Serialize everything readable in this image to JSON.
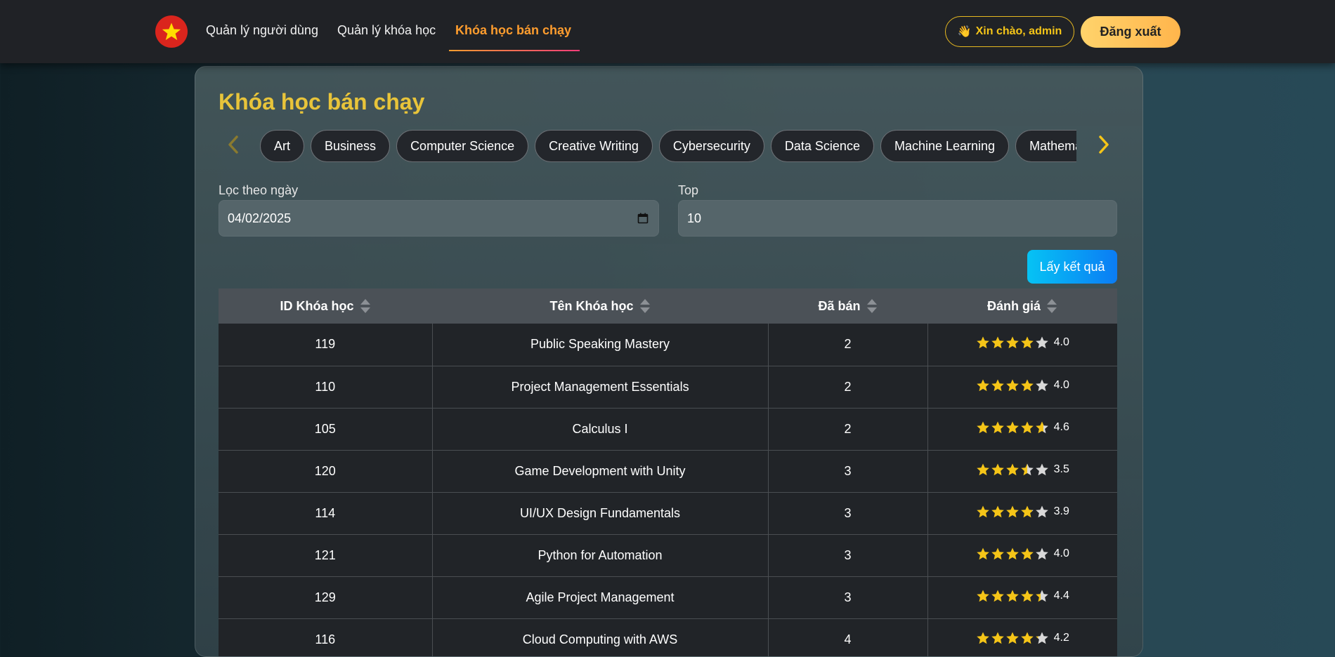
{
  "nav": {
    "logo": "vietnam-flag-star",
    "links": [
      {
        "label": "Quản lý người dùng"
      },
      {
        "label": "Quản lý khóa học"
      },
      {
        "label": "Khóa học bán chạy"
      }
    ],
    "active_index": 2,
    "greeting": "Xin chào, admin",
    "greeting_icon": "waving-hand",
    "logout_label": "Đăng xuất"
  },
  "page": {
    "title": "Khóa học bán chạy"
  },
  "categories": [
    "Art",
    "Business",
    "Computer Science",
    "Creative Writing",
    "Cybersecurity",
    "Data Science",
    "Machine Learning",
    "Mathematics"
  ],
  "filters": {
    "date_label": "Lọc theo ngày",
    "date_value": "04/02/2025",
    "top_label": "Top",
    "top_value": "10",
    "submit_label": "Lấy kết quả"
  },
  "table": {
    "headers": [
      "ID Khóa học",
      "Tên Khóa học",
      "Đã bán",
      "Đánh giá"
    ],
    "rows": [
      {
        "id": "119",
        "name": "Public Speaking Mastery",
        "sold": "2",
        "rating": "4.0"
      },
      {
        "id": "110",
        "name": "Project Management Essentials",
        "sold": "2",
        "rating": "4.0"
      },
      {
        "id": "105",
        "name": "Calculus I",
        "sold": "2",
        "rating": "4.6"
      },
      {
        "id": "120",
        "name": "Game Development with Unity",
        "sold": "3",
        "rating": "3.5"
      },
      {
        "id": "114",
        "name": "UI/UX Design Fundamentals",
        "sold": "3",
        "rating": "3.9"
      },
      {
        "id": "121",
        "name": "Python for Automation",
        "sold": "3",
        "rating": "4.0"
      },
      {
        "id": "129",
        "name": "Agile Project Management",
        "sold": "3",
        "rating": "4.4"
      },
      {
        "id": "116",
        "name": "Cloud Computing with AWS",
        "sold": "4",
        "rating": "4.2"
      }
    ]
  },
  "colors": {
    "accent": "#ff9d2e",
    "title": "#e8c43a",
    "star": "#f5c518",
    "star_empty": "#d9d9d9"
  }
}
